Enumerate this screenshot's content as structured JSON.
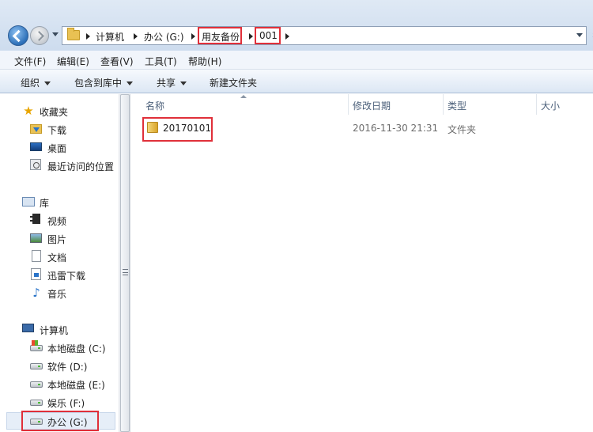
{
  "address": {
    "crumbs": [
      "计算机",
      "办公 (G:)",
      "用友备份",
      "001"
    ]
  },
  "menu": [
    "文件(F)",
    "编辑(E)",
    "查看(V)",
    "工具(T)",
    "帮助(H)"
  ],
  "toolbar": [
    "组织",
    "包含到库中",
    "共享",
    "新建文件夹"
  ],
  "nav": {
    "favorites_title": "收藏夹",
    "favorites": [
      "下载",
      "桌面",
      "最近访问的位置"
    ],
    "libraries_title": "库",
    "libraries": [
      "视频",
      "图片",
      "文档",
      "迅雷下载",
      "音乐"
    ],
    "computer_title": "计算机",
    "drives": [
      "本地磁盘 (C:)",
      "软件 (D:)",
      "本地磁盘 (E:)",
      "娱乐 (F:)",
      "办公 (G:)"
    ]
  },
  "columns": [
    "名称",
    "修改日期",
    "类型",
    "大小"
  ],
  "files": [
    {
      "name": "20170101",
      "date": "2016-11-30 21:31",
      "type": "文件夹"
    }
  ],
  "colors": {
    "highlight": "#e0303a",
    "selection": "#e6eef8"
  }
}
